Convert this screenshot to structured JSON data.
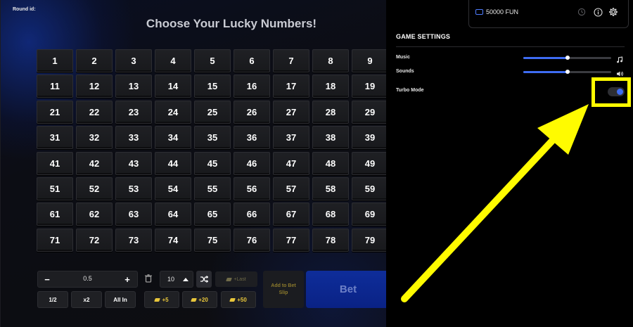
{
  "game": {
    "round_id_label": "Round id:",
    "title": "Choose Your Lucky Numbers!",
    "numbers": [
      "1",
      "2",
      "3",
      "4",
      "5",
      "6",
      "7",
      "8",
      "9",
      "11",
      "12",
      "13",
      "14",
      "15",
      "16",
      "17",
      "18",
      "19",
      "21",
      "22",
      "23",
      "24",
      "25",
      "26",
      "27",
      "28",
      "29",
      "31",
      "32",
      "33",
      "34",
      "35",
      "36",
      "37",
      "38",
      "39",
      "41",
      "42",
      "43",
      "44",
      "45",
      "46",
      "47",
      "48",
      "49",
      "51",
      "52",
      "53",
      "54",
      "55",
      "56",
      "57",
      "58",
      "59",
      "61",
      "62",
      "63",
      "64",
      "65",
      "66",
      "67",
      "68",
      "69",
      "71",
      "72",
      "73",
      "74",
      "75",
      "76",
      "77",
      "78",
      "79"
    ]
  },
  "controls": {
    "stake_minus": "−",
    "stake_value": "0.5",
    "stake_plus": "+",
    "half_label": "1/2",
    "double_label": "x2",
    "all_in_label": "All In",
    "quick_pick_count": "10",
    "plus_last_label": "+Last",
    "chip_buttons": [
      "+5",
      "+20",
      "+50"
    ],
    "add_to_slip_label": "Add to Bet Slip",
    "bet_label": "Bet"
  },
  "header": {
    "balance": "50000 FUN",
    "icons": [
      "history-icon",
      "info-icon",
      "gear-icon"
    ]
  },
  "settings": {
    "title": "GAME SETTINGS",
    "music_label": "Music",
    "sounds_label": "Sounds",
    "turbo_label": "Turbo Mode",
    "music_level": 0.5,
    "sounds_level": 0.5,
    "turbo_on": true,
    "accent_color": "#3e6cf2",
    "highlight_color": "#fffb00"
  }
}
